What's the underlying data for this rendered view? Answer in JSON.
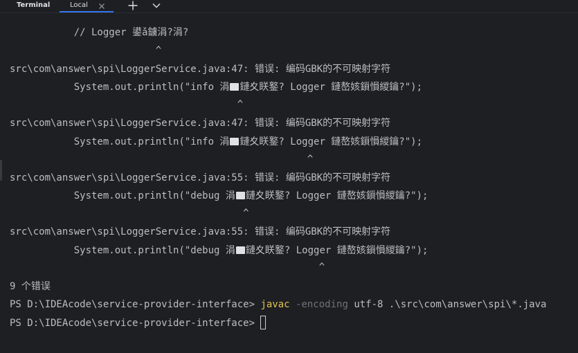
{
  "tabbar": {
    "title": "Terminal",
    "tab_label": "Local",
    "add_icon": "plus-icon",
    "chevron_icon": "chevron-down-icon",
    "close_icon": "close-icon"
  },
  "colors": {
    "background": "#1e1f22",
    "text": "#bcbec4",
    "command": "#e0c34f",
    "flag": "#6f737a",
    "accent": "#3574f0"
  },
  "terminal": {
    "lines": [
      "           // Logger 鍙ǎ鐪涓?涓?",
      "                         ^",
      "src\\com\\answer\\spi\\LoggerService.java:47: 错误: 编码GBK的不可映射字符",
      "           System.out.println(\"info 涓",
      "                                       ^",
      "src\\com\\answer\\spi\\LoggerService.java:47: 错误: 编码GBK的不可映射字符",
      "           System.out.println(\"info 涓",
      "                                                   ^",
      "src\\com\\answer\\spi\\LoggerService.java:55: 错误: 编码GBK的不可映射字符",
      "           System.out.println(\"debug 涓",
      "                                        ^",
      "src\\com\\answer\\spi\\LoggerService.java:55: 错误: 编码GBK的不可映射字符",
      "           System.out.println(\"debug 涓",
      "                                                     ^",
      "9 个错误"
    ],
    "line_tails": {
      "info_tail": "鏈夊眹鐜? Logger 鏈嶅姟鎻愪緵鑰?\");",
      "debug_tail": "鏈夊眹鐜? Logger 鏈嶅姟鎻愪緵鑰?\");"
    },
    "prompt": "PS D:\\IDEAcode\\service-provider-interface> ",
    "command_javac": "javac",
    "command_flag": " -encoding",
    "command_rest": " utf-8 .\\src\\com\\answer\\spi\\*.java"
  }
}
